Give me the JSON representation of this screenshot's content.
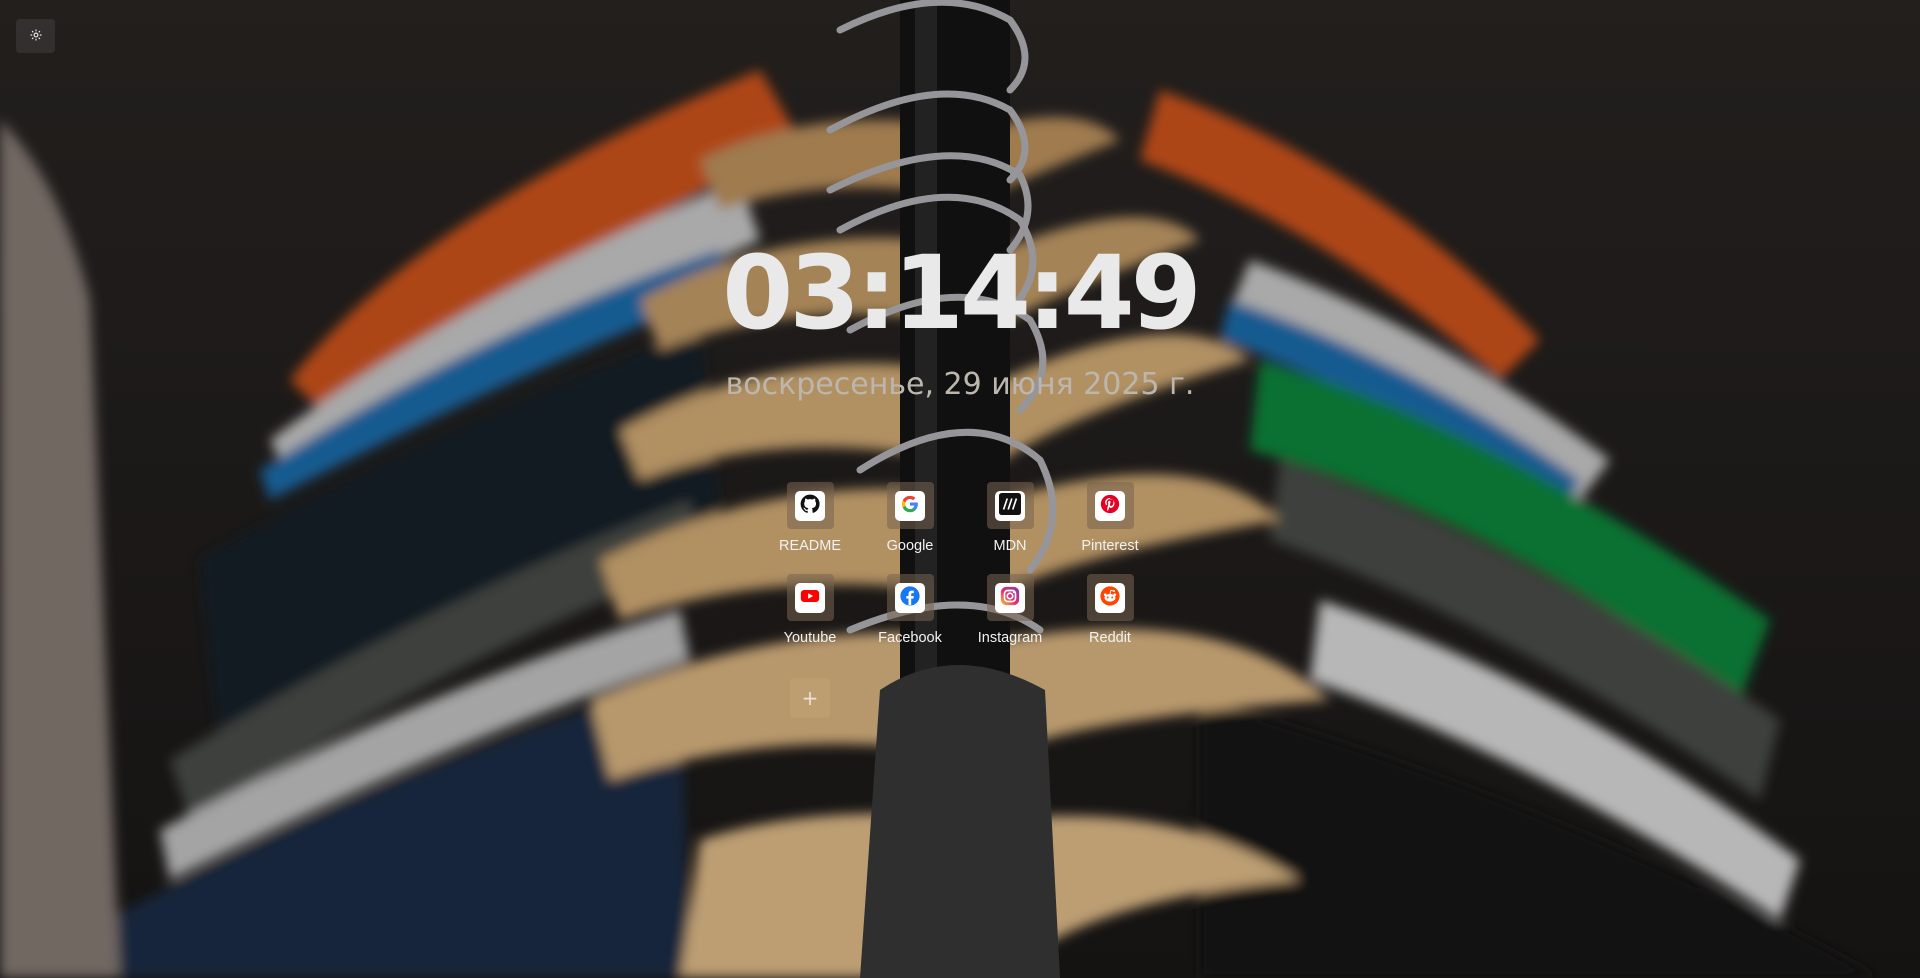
{
  "clock": {
    "time": "03:14:49"
  },
  "date": {
    "text": "воскресенье, 29 июня 2025 г."
  },
  "settings": {
    "icon": "gear-icon"
  },
  "shortcuts": [
    {
      "label": "README",
      "icon": "github-icon"
    },
    {
      "label": "Google",
      "icon": "google-icon"
    },
    {
      "label": "MDN",
      "icon": "mdn-icon"
    },
    {
      "label": "Pinterest",
      "icon": "pinterest-icon"
    },
    {
      "label": "Youtube",
      "icon": "youtube-icon"
    },
    {
      "label": "Facebook",
      "icon": "facebook-icon"
    },
    {
      "label": "Instagram",
      "icon": "instagram-icon"
    },
    {
      "label": "Reddit",
      "icon": "reddit-icon"
    }
  ],
  "add_shortcut": {
    "glyph": "+",
    "icon": "plus-icon"
  },
  "colors": {
    "clock_text": "#e9e9e9",
    "date_text": "#bdb6ad",
    "pinterest": "#e60023",
    "youtube": "#ff0000",
    "facebook": "#1877f2",
    "reddit": "#ff4500"
  }
}
